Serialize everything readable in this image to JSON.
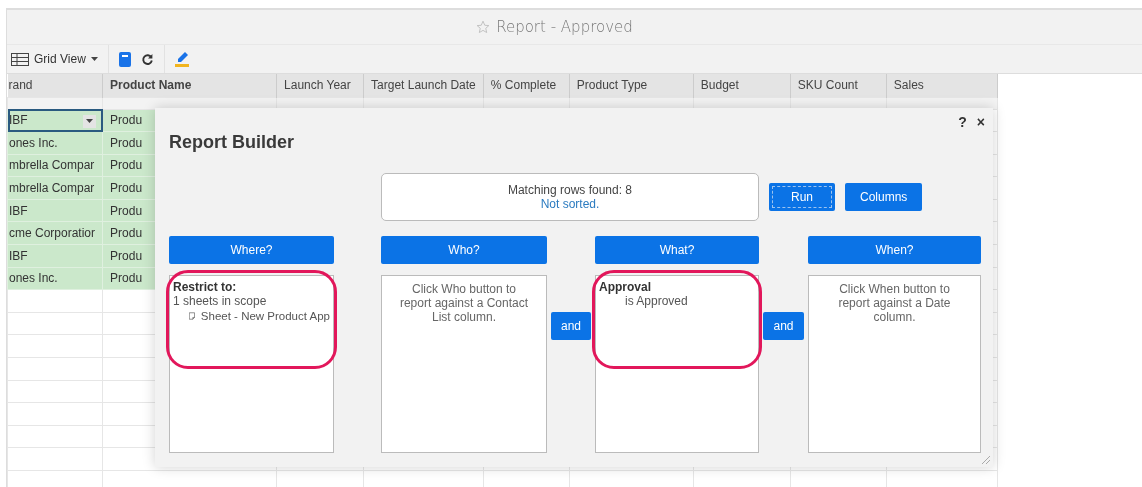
{
  "window": {
    "title": "Report - Approved"
  },
  "toolbar": {
    "view_label": "Grid View"
  },
  "table": {
    "columns": [
      "rand",
      "Product Name",
      "Launch Year",
      "Target Launch Date",
      "% Complete",
      "Product Type",
      "Budget",
      "SKU Count",
      "Sales"
    ],
    "rows": [
      {
        "cells": [
          "IBF",
          "Produ"
        ],
        "selected": true
      },
      {
        "cells": [
          "ones Inc.",
          "Produ"
        ],
        "selected": false
      },
      {
        "cells": [
          "mbrella Compar",
          "Produ"
        ],
        "selected": false
      },
      {
        "cells": [
          "mbrella Compar",
          "Produ"
        ],
        "selected": false
      },
      {
        "cells": [
          "IBF",
          "Produ"
        ],
        "selected": false
      },
      {
        "cells": [
          "cme Corporatior",
          "Produ"
        ],
        "selected": false
      },
      {
        "cells": [
          "IBF",
          "Produ"
        ],
        "selected": false
      },
      {
        "cells": [
          "ones Inc.",
          "Produ"
        ],
        "selected": false
      }
    ]
  },
  "dialog": {
    "title": "Report Builder",
    "help": "?",
    "close": "×",
    "summary": {
      "count": "Matching rows found: 8",
      "sort": "Not sorted."
    },
    "actions": [
      "Run",
      "Columns"
    ],
    "panels": [
      {
        "button": "Where?",
        "highlighted": true,
        "kind": "scope",
        "heading": "Restrict to:",
        "lines": [
          "1 sheets in scope"
        ],
        "items": [
          "Sheet - New Product App"
        ]
      },
      {
        "button": "Who?",
        "highlighted": false,
        "kind": "hint",
        "text": "Click Who button to report against a Contact List column."
      },
      {
        "button": "What?",
        "highlighted": true,
        "kind": "criteria",
        "heading": "Approval",
        "lines": [
          "is Approved"
        ]
      },
      {
        "button": "When?",
        "highlighted": false,
        "kind": "hint",
        "text": "Click When button to report against a Date column."
      }
    ],
    "joiners": [
      "and",
      "and"
    ]
  }
}
